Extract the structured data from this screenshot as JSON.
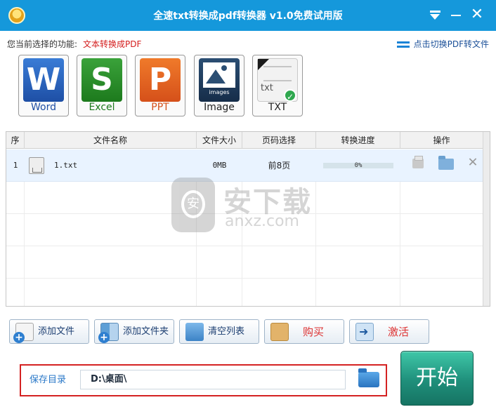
{
  "window": {
    "title": "全速txt转换成pdf转换器 v1.0免费试用版",
    "menu_glyph": "",
    "close_glyph": "✕"
  },
  "function_bar": {
    "label": "您当前选择的功能:",
    "value": "文本转换成PDF",
    "switch_link": "点击切换PDF转文件"
  },
  "formats": [
    {
      "tile": "W",
      "label": "Word",
      "color": "#1e4fa5"
    },
    {
      "tile": "S",
      "label": "Excel",
      "color": "#1d7a1d"
    },
    {
      "tile": "P",
      "label": "PPT",
      "color": "#d5501a"
    },
    {
      "tile": "images",
      "label": "Image",
      "color": "#162d49"
    },
    {
      "tile": "txt",
      "label": "TXT",
      "color": "#f2f2f2",
      "selected": true
    }
  ],
  "table": {
    "columns": [
      "序",
      "文件名称",
      "文件大小",
      "页码选择",
      "转换进度",
      "操作"
    ],
    "rows": [
      {
        "index": "1",
        "name": "1.txt",
        "size": "0MB",
        "pages": "前8页",
        "progress": 0,
        "progress_text": "0%"
      }
    ]
  },
  "watermark": {
    "cn": "安下载",
    "en": "anxz.com",
    "shield": "安"
  },
  "actions": {
    "add_file": "添加文件",
    "add_folder": "添加文件夹",
    "clear_list": "清空列表",
    "buy": "购买",
    "activate": "激活"
  },
  "save": {
    "label": "保存目录",
    "path": "D:\\桌面\\"
  },
  "start_label": "开始",
  "colors": {
    "titlebar": "#1598db",
    "accent_red": "#d42222",
    "start_button": "#1f8f7b"
  }
}
